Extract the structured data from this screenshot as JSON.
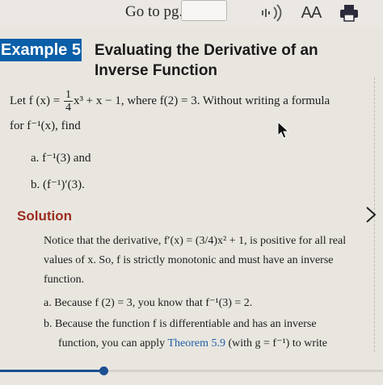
{
  "toolbar": {
    "goto_label": "Go to pg.",
    "goto_value": "",
    "text_size_label": "AA",
    "icons": [
      "audio-icon",
      "text-size-icon",
      "print-icon"
    ]
  },
  "example": {
    "tag": "Example 5",
    "title": "Evaluating the Derivative of an Inverse Function",
    "intro_prefix": "Let f (x) = ",
    "frac_num": "1",
    "frac_den": "4",
    "intro_suffix": "x³ + x − 1, where f(2) = 3. Without writing a formula",
    "intro_line2": "for f⁻¹(x), find",
    "item_a": "a.  f⁻¹(3) and",
    "item_b": "b.  (f⁻¹)′(3)."
  },
  "solution": {
    "heading": "Solution",
    "paragraph": "Notice that the derivative, f′(x) = (3/4)x² + 1, is positive for all real values of x. So, f is strictly monotonic and must have an inverse function.",
    "step_a": "a.  Because f (2) = 3, you know that f⁻¹(3) = 2.",
    "step_b_line1": "b.  Because the function f is differentiable and has an inverse",
    "step_b_prefix": "function, you can apply ",
    "step_b_link": "Theorem 5.9",
    "step_b_suffix": " (with g = f⁻¹) to write"
  },
  "progress": {
    "fraction": 0.27
  },
  "colors": {
    "accent": "#0b5fa8",
    "solution_heading": "#9b2d1f",
    "link": "#1f5ea8"
  }
}
